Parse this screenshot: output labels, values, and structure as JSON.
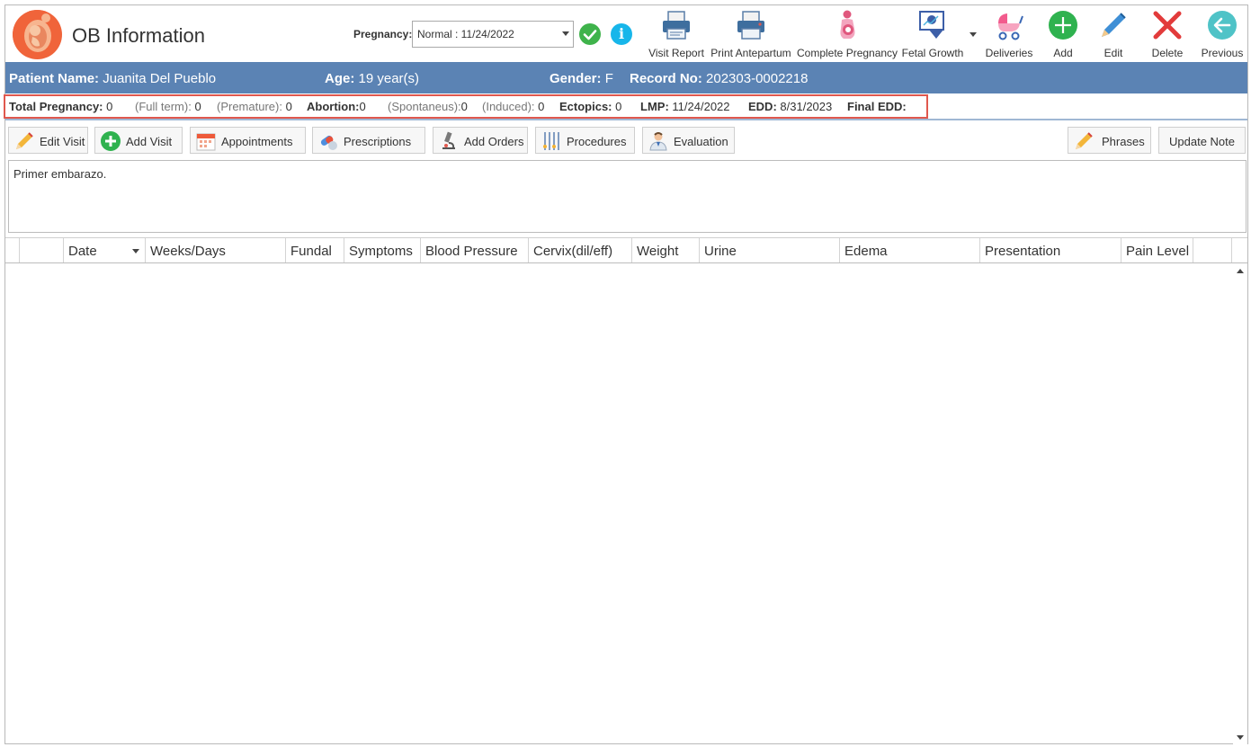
{
  "header": {
    "title": "OB Information",
    "pregnancy_label": "Pregnancy:",
    "pregnancy_value": "Normal : 11/24/2022",
    "info_glyph": "i"
  },
  "toolbar": {
    "visit_report": "Visit Report",
    "print_antepartum": "Print Antepartum",
    "complete_pregnancy": "Complete Pregnancy",
    "fetal_growth": "Fetal Growth",
    "deliveries": "Deliveries",
    "add": "Add",
    "edit": "Edit",
    "delete": "Delete",
    "previous": "Previous"
  },
  "patient": {
    "name_label": "Patient Name:",
    "name": "Juanita Del Pueblo",
    "age_label": "Age:",
    "age": "19 year(s)",
    "gender_label": "Gender:",
    "gender": "F",
    "record_label": "Record No:",
    "record": "202303-0002218"
  },
  "summary": {
    "total_pregnancy_label": "Total Pregnancy:",
    "total_pregnancy": "0",
    "full_term_label": "(Full term):",
    "full_term": "0",
    "premature_label": "(Premature):",
    "premature": "0",
    "abortion_label": "Abortion:",
    "abortion": "0",
    "spontaneus_label": "(Spontaneus):",
    "spontaneus": "0",
    "induced_label": "(Induced):",
    "induced": "0",
    "ectopics_label": "Ectopics:",
    "ectopics": "0",
    "lmp_label": "LMP:",
    "lmp": "11/24/2022",
    "edd_label": "EDD:",
    "edd": "8/31/2023",
    "final_edd_label": "Final EDD:",
    "final_edd": ""
  },
  "actions": {
    "edit_visit": "Edit Visit",
    "add_visit": "Add Visit",
    "appointments": "Appointments",
    "prescriptions": "Prescriptions",
    "add_orders": "Add Orders",
    "procedures": "Procedures",
    "evaluation": "Evaluation",
    "phrases": "Phrases",
    "update_note": "Update Note"
  },
  "notes": {
    "text": "Primer embarazo."
  },
  "grid": {
    "columns": [
      "Date",
      "Weeks/Days",
      "Fundal",
      "Symptoms",
      "Blood Pressure",
      "Cervix(dil/eff)",
      "Weight",
      "Urine",
      "Edema",
      "Presentation",
      "Pain Level"
    ],
    "rows": []
  },
  "colors": {
    "patient_bar": "#5b83b4",
    "highlight_box": "#e0584e",
    "check_green": "#3fb34b",
    "info_blue": "#17b6ea",
    "add_green": "#2fb24f",
    "delete_red": "#e23b3b",
    "previous_teal": "#4fc3c7",
    "logo_orange": "#f0643a"
  }
}
